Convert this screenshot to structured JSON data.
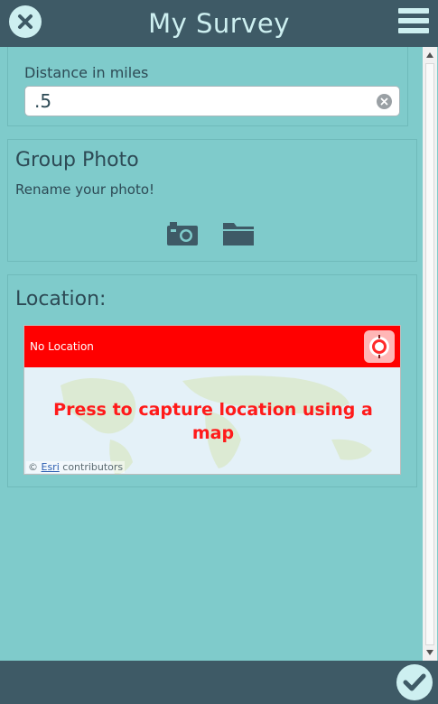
{
  "header": {
    "title": "My Survey",
    "close_icon": "close-icon",
    "menu_icon": "hamburger-menu-icon"
  },
  "distance_section": {
    "label": "Distance in miles",
    "value": ".5",
    "clear_icon": "clear-icon"
  },
  "photo_section": {
    "heading": "Group Photo",
    "hint": "Rename your photo!",
    "camera_icon": "camera-icon",
    "folder_icon": "folder-icon"
  },
  "location_section": {
    "heading": "Location:",
    "status": "No Location",
    "prompt": "Press to capture location using a map",
    "gps_icon": "gps-target-icon",
    "attribution_prefix": "©",
    "attribution_link": "Esri",
    "attribution_suffix": "contributors"
  },
  "footer": {
    "submit_icon": "checkmark-icon"
  },
  "colors": {
    "header_bg": "#3e5a66",
    "page_bg": "#7fcbcb",
    "map_bar": "#ff0000",
    "prompt_text": "#ff1a1a"
  }
}
